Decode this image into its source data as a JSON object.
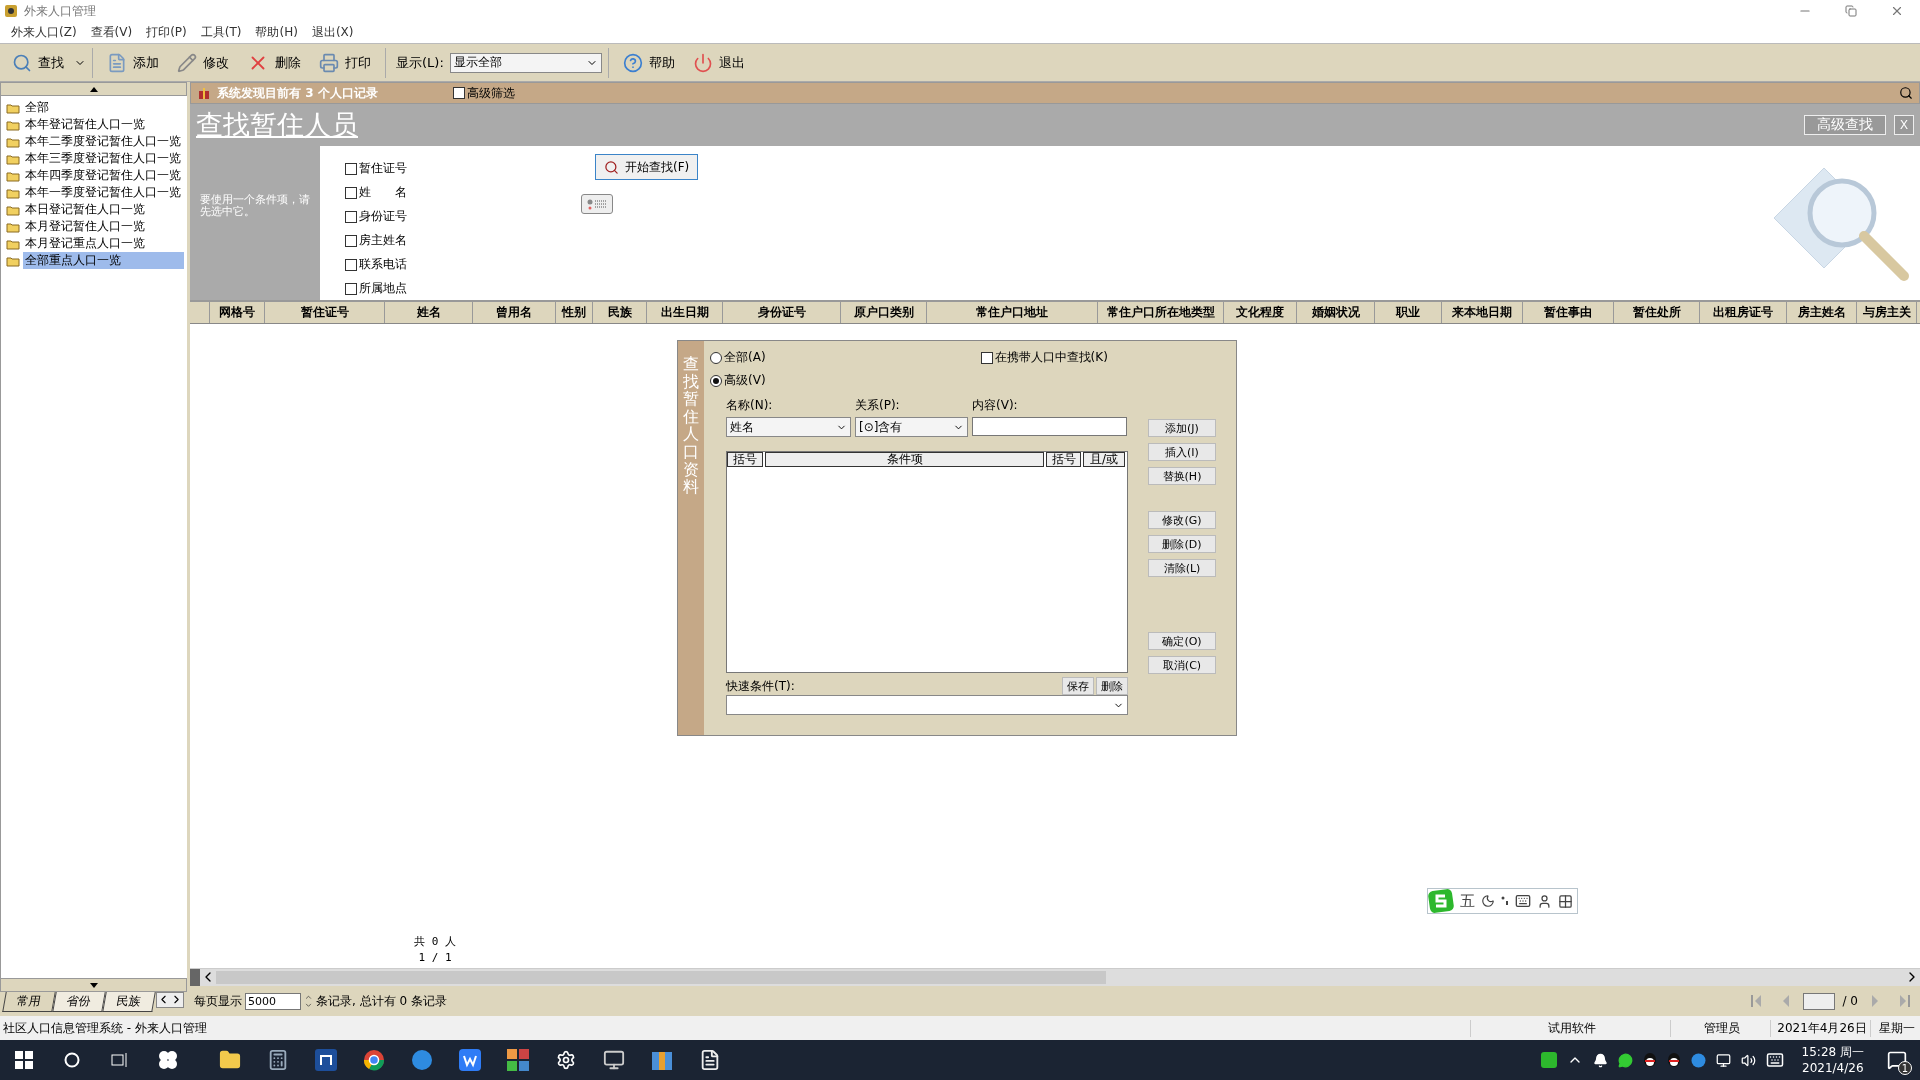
{
  "window": {
    "title": "外来人口管理"
  },
  "menu": [
    "外来人口(Z)",
    "查看(V)",
    "打印(P)",
    "工具(T)",
    "帮助(H)",
    "退出(X)"
  ],
  "toolbar": {
    "buttons": [
      {
        "kind": "search",
        "label": "查找"
      },
      {
        "kind": "add",
        "label": "添加"
      },
      {
        "kind": "edit",
        "label": "修改"
      },
      {
        "kind": "delete",
        "label": "删除"
      },
      {
        "kind": "print",
        "label": "打印"
      }
    ],
    "display_label": "显示(L):",
    "display_value": "显示全部",
    "buttons_right": [
      {
        "kind": "help",
        "label": "帮助"
      },
      {
        "kind": "exit",
        "label": "退出"
      }
    ]
  },
  "sidebar": {
    "items": [
      {
        "label": "全部",
        "selected": false
      },
      {
        "label": "本年登记暂住人口一览",
        "selected": false
      },
      {
        "label": "本年二季度登记暂住人口一览",
        "selected": false
      },
      {
        "label": "本年三季度登记暂住人口一览",
        "selected": false
      },
      {
        "label": "本年四季度登记暂住人口一览",
        "selected": false
      },
      {
        "label": "本年一季度登记暂住人口一览",
        "selected": false
      },
      {
        "label": "本日登记暂住人口一览",
        "selected": false
      },
      {
        "label": "本月登记暂住人口一览",
        "selected": false
      },
      {
        "label": "本月登记重点人口一览",
        "selected": false
      },
      {
        "label": "全部重点人口一览",
        "selected": true
      }
    ],
    "tabs": [
      {
        "label": "常用",
        "selected": true
      },
      {
        "label": "省份",
        "selected": false
      },
      {
        "label": "民族",
        "selected": false
      }
    ]
  },
  "banner": {
    "text": "系统发现目前有 3 个人口记录",
    "filter": {
      "label": "高级筛选",
      "checked": false
    }
  },
  "search_panel": {
    "title": "查找暂住人员",
    "advanced_button": "高级查找",
    "close_button": "X",
    "hint": "要使用一个条件项，请先选中它。",
    "fields": [
      {
        "label": "暂住证号",
        "checked": false
      },
      {
        "label": "姓　　名",
        "checked": false
      },
      {
        "label": "身份证号",
        "checked": false
      },
      {
        "label": "房主姓名",
        "checked": false
      },
      {
        "label": "联系电话",
        "checked": false
      },
      {
        "label": "所属地点",
        "checked": false
      }
    ],
    "start_button": "开始查找(F)"
  },
  "table": {
    "columns": [
      "网格号",
      "暂住证号",
      "姓名",
      "曾用名",
      "性别",
      "民族",
      "出生日期",
      "身份证号",
      "原户口类别",
      "常住户口地址",
      "常住户口所在地类型",
      "文化程度",
      "婚姻状况",
      "职业",
      "来本地日期",
      "暂住事由",
      "暂住处所",
      "出租房证号",
      "房主姓名",
      "与房主关"
    ],
    "total": "共 0 人",
    "page": "1 / 1"
  },
  "dialog": {
    "title": "查找暂住人口资料",
    "modes": [
      {
        "label": "全部(A)",
        "selected": false
      },
      {
        "label": "高级(V)",
        "selected": true
      }
    ],
    "carry": {
      "label": "在携带人口中查找(K)",
      "checked": false
    },
    "name_label": "名称(N):",
    "name_value": "姓名",
    "relation_label": "关系(P):",
    "relation_value": "[⊙]含有",
    "content_label": "内容(V):",
    "grid_columns": [
      "括号",
      "条件项",
      "括号",
      "且/或"
    ],
    "buttons": [
      "添加(J)",
      "插入(I)",
      "替换(H)",
      "修改(G)",
      "删除(D)",
      "清除(L)",
      "确定(O)",
      "取消(C)"
    ],
    "quick_label": "快速条件(T):",
    "quick_buttons": [
      "保存",
      "删除"
    ]
  },
  "pager": {
    "per_page_label": "每页显示",
    "per_page": "5000",
    "records": "条记录, 总计有 0 条记录",
    "of": "/ 0"
  },
  "status_bar": [
    "社区人口信息管理系统 - 外来人口管理",
    "试用软件",
    "管理员",
    "2021年4月26日",
    "星期一"
  ],
  "ime": {
    "mode": "五"
  },
  "taskbar": {
    "time": "15:28 周一",
    "date": "2021/4/26",
    "notifications": "1"
  }
}
